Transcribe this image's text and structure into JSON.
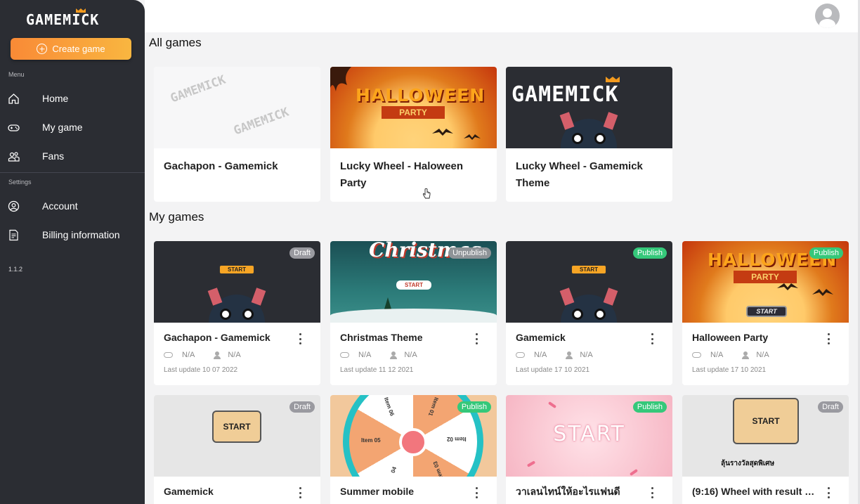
{
  "app": {
    "logo_text": "GAMEMICK",
    "create_button": "Create game",
    "menu_label": "Menu",
    "settings_label": "Settings",
    "version": "1.1.2",
    "nav": [
      {
        "label": "Home",
        "icon": "home-icon"
      },
      {
        "label": "My game",
        "icon": "gamepad-icon"
      },
      {
        "label": "Fans",
        "icon": "users-icon"
      }
    ],
    "settings_nav": [
      {
        "label": "Account",
        "icon": "user-circle-icon"
      },
      {
        "label": "Billing information",
        "icon": "document-icon"
      }
    ],
    "accent_gradient": [
      "#f98a36",
      "#f9b640"
    ],
    "sidebar_color": "#2b2d33"
  },
  "all_games": {
    "heading": "All games",
    "items": [
      {
        "title": "Gachapon - Gamemick",
        "thumb": "gamemick-watermark",
        "watermark": "GAMEMICK"
      },
      {
        "title": "Lucky Wheel - Haloween Party",
        "thumb": "halloween-party",
        "art_title": "HALLOWEEN",
        "art_sub": "PARTY"
      },
      {
        "title": "Lucky Wheel - Gamemick Theme",
        "thumb": "gamemick-logo",
        "art_title": "GAMEMICK"
      }
    ]
  },
  "my_games": {
    "heading": "My games",
    "items": [
      {
        "title": "Gachapon - Gamemick",
        "status": "Draft",
        "plays": "N/A",
        "players": "N/A",
        "updated": "Last update 10 07 2022",
        "start": "START"
      },
      {
        "title": "Christmas Theme",
        "status": "Unpublish",
        "plays": "N/A",
        "players": "N/A",
        "updated": "Last update 11 12 2021",
        "art_title": "Christmas",
        "start": "START"
      },
      {
        "title": "Gamemick",
        "status": "Publish",
        "plays": "N/A",
        "players": "N/A",
        "updated": "Last update 17 10 2021",
        "start": "START"
      },
      {
        "title": "Halloween Party",
        "status": "Publish",
        "plays": "N/A",
        "players": "N/A",
        "updated": "Last update 17 10 2021",
        "art_title": "HALLOWEEN",
        "art_sub": "PARTY",
        "start": "START"
      },
      {
        "title": "Gamemick",
        "status": "Draft",
        "start": "START"
      },
      {
        "title": "Summer mobile",
        "status": "Publish",
        "wheel_items": [
          "Item 05",
          "Item 06",
          "Item 01",
          "Item 02",
          "Item 03",
          "04"
        ]
      },
      {
        "title": "วาเลนไทน์ให้อะไรแฟนดี",
        "status": "Publish",
        "start": "START"
      },
      {
        "title": "(9:16) Wheel with result p...",
        "status": "Draft",
        "start": "START",
        "thai_text": "ลุ้นรางวัลสุดพิเศษ"
      }
    ]
  },
  "status_colors": {
    "Draft": "#9a9aa0",
    "Unpublish": "#8e9397",
    "Publish": "#35c87a"
  }
}
